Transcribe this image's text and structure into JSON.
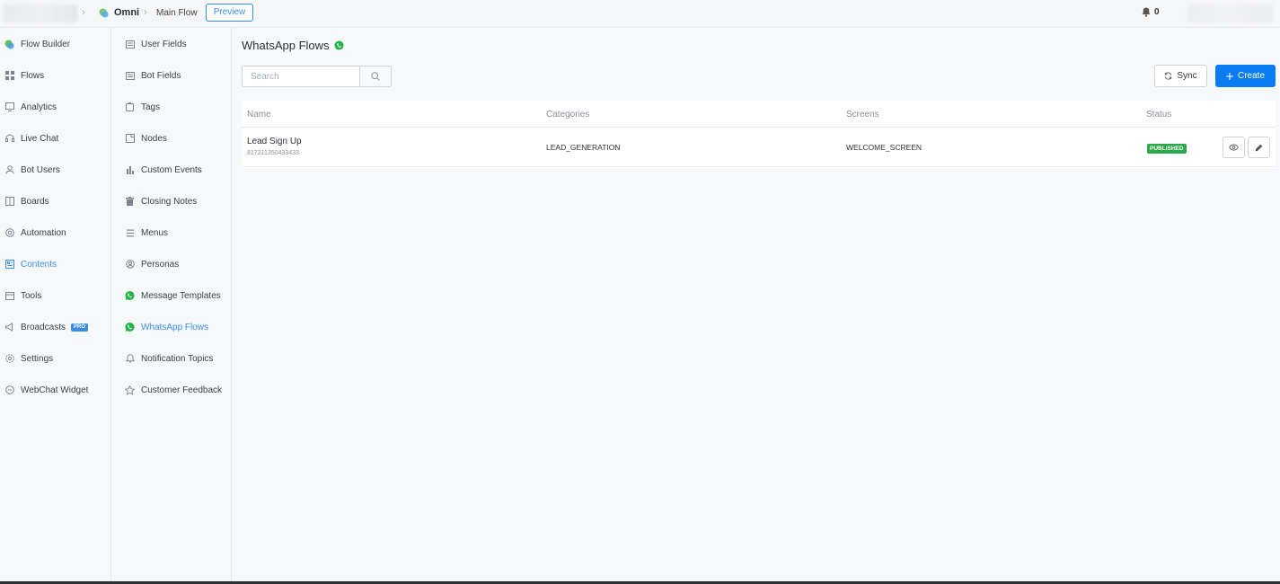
{
  "topbar": {
    "bot_name": "Omni",
    "flow_name": "Main Flow",
    "preview_label": "Preview",
    "notification_count": "0"
  },
  "sidebar_main": {
    "items": [
      {
        "label": "Flow Builder",
        "icon": "flow-builder-icon",
        "active": false
      },
      {
        "label": "Flows",
        "icon": "grid-icon",
        "active": false
      },
      {
        "label": "Analytics",
        "icon": "chart-icon",
        "active": false
      },
      {
        "label": "Live Chat",
        "icon": "headset-icon",
        "active": false
      },
      {
        "label": "Bot Users",
        "icon": "user-icon",
        "active": false
      },
      {
        "label": "Boards",
        "icon": "board-icon",
        "active": false
      },
      {
        "label": "Automation",
        "icon": "automation-icon",
        "active": false
      },
      {
        "label": "Contents",
        "icon": "contents-icon",
        "active": true
      },
      {
        "label": "Tools",
        "icon": "tools-icon",
        "active": false
      },
      {
        "label": "Broadcasts",
        "icon": "megaphone-icon",
        "active": false,
        "badge": "PRO"
      },
      {
        "label": "Settings",
        "icon": "gear-icon",
        "active": false
      },
      {
        "label": "WebChat Widget",
        "icon": "chat-bubble-icon",
        "active": false
      }
    ]
  },
  "sidebar_contents": {
    "items": [
      {
        "label": "User Fields",
        "icon": "field-icon",
        "active": false
      },
      {
        "label": "Bot Fields",
        "icon": "field-icon",
        "active": false
      },
      {
        "label": "Tags",
        "icon": "tag-icon",
        "active": false
      },
      {
        "label": "Nodes",
        "icon": "node-icon",
        "active": false
      },
      {
        "label": "Custom Events",
        "icon": "bar-chart-icon",
        "active": false
      },
      {
        "label": "Closing Notes",
        "icon": "trash-icon",
        "active": false
      },
      {
        "label": "Menus",
        "icon": "menu-icon",
        "active": false
      },
      {
        "label": "Personas",
        "icon": "persona-icon",
        "active": false
      },
      {
        "label": "Message Templates",
        "icon": "whatsapp-icon",
        "active": false
      },
      {
        "label": "WhatsApp Flows",
        "icon": "whatsapp-icon",
        "active": true
      },
      {
        "label": "Notification Topics",
        "icon": "bell-icon",
        "active": false
      },
      {
        "label": "Customer Feedback",
        "icon": "star-icon",
        "active": false
      }
    ]
  },
  "main": {
    "title": "WhatsApp Flows",
    "search_placeholder": "Search",
    "sync_label": "Sync",
    "create_label": "Create",
    "columns": [
      "Name",
      "Categories",
      "Screens",
      "Status"
    ],
    "rows": [
      {
        "name": "Lead Sign Up",
        "id": "817211350433433",
        "category": "LEAD_GENERATION",
        "screens": "WELCOME_SCREEN",
        "status": "PUBLISHED"
      }
    ]
  },
  "colors": {
    "accent": "#3a8ee6",
    "primary_button": "#0a7cf2",
    "published": "#2aa84a",
    "whatsapp": "#25b34a"
  }
}
